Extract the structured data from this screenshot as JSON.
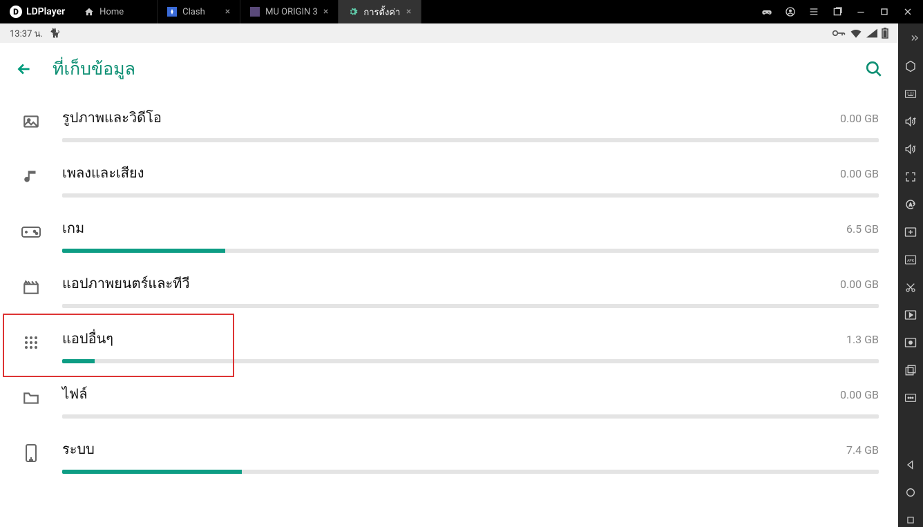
{
  "app": {
    "name": "LDPlayer"
  },
  "tabs": [
    {
      "label": "Home",
      "icon": "home",
      "closeable": false,
      "active": false
    },
    {
      "label": "Clash",
      "icon": "clash",
      "closeable": true,
      "active": false
    },
    {
      "label": "MU ORIGIN 3",
      "icon": "mu",
      "closeable": true,
      "active": false
    },
    {
      "label": "การตั้งค่า",
      "icon": "gear",
      "closeable": true,
      "active": true
    }
  ],
  "statusbar": {
    "time": "13:37 น.",
    "cat": "🐱"
  },
  "page": {
    "title": "ที่เก็บข้อมูล"
  },
  "accent": "#0d9d84",
  "storage": [
    {
      "label": "รูปภาพและวิดีโอ",
      "size": "0.00 GB",
      "pct": 0,
      "icon": "image"
    },
    {
      "label": "เพลงและเสียง",
      "size": "0.00 GB",
      "pct": 0,
      "icon": "music"
    },
    {
      "label": "เกม",
      "size": "6.5 GB",
      "pct": 20,
      "icon": "gamepad"
    },
    {
      "label": "แอปภาพยนตร์และทีวี",
      "size": "0.00 GB",
      "pct": 0,
      "icon": "movie"
    },
    {
      "label": "แอปอื่นๆ",
      "size": "1.3 GB",
      "pct": 4,
      "icon": "apps",
      "highlight": true
    },
    {
      "label": "ไฟล์",
      "size": "0.00 GB",
      "pct": 0,
      "icon": "folder"
    },
    {
      "label": "ระบบ",
      "size": "7.4 GB",
      "pct": 22,
      "icon": "system"
    }
  ],
  "side_tools": [
    "hex",
    "keyboard",
    "vol-up",
    "vol-down",
    "fullscreen",
    "sync",
    "add",
    "apk",
    "cut",
    "play",
    "rec",
    "multi",
    "more"
  ],
  "nav_tools": [
    "back-tri",
    "circle",
    "square"
  ]
}
